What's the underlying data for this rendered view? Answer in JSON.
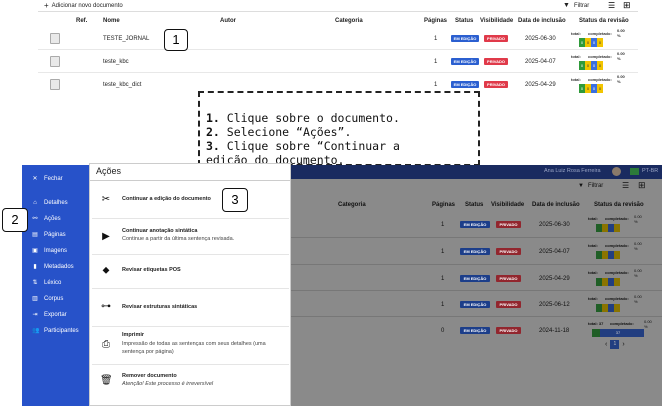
{
  "top": {
    "add_doc": "Adicionar novo documento",
    "filter": "Filtrar",
    "columns": {
      "ref": "Ref.",
      "name": "Nome",
      "author": "Autor",
      "category": "Categoria",
      "pages": "Páginas",
      "status": "Status",
      "visibility": "Visibilidade",
      "date": "Data de inclusão",
      "review": "Status da revisão"
    },
    "rows": [
      {
        "name": "TESTE_JORNAL",
        "pages": "1",
        "status": "EM EDIÇÃO",
        "visibility": "PRIVADO",
        "date": "2025-06-30",
        "prog": [
          "0",
          "0",
          "0",
          "0"
        ]
      },
      {
        "name": "teste_kbc",
        "pages": "1",
        "status": "EM EDIÇÃO",
        "visibility": "PRIVADO",
        "date": "2025-04-07",
        "prog": [
          "0",
          "0",
          "0",
          "0"
        ]
      },
      {
        "name": "teste_kbc_dict",
        "pages": "1",
        "status": "EM EDIÇÃO",
        "visibility": "PRIVADO",
        "date": "2025-04-29",
        "prog": [
          "0",
          "0",
          "0",
          "0"
        ]
      }
    ],
    "review_total": "total:",
    "review_done": "completado:",
    "review_pct": "0.00 %"
  },
  "callouts": {
    "one": "1",
    "two": "2",
    "three": "3"
  },
  "instructions": {
    "n1": "1.",
    "t1": " Clique sobre o documento.",
    "n2": "2.",
    "t2": " Selecione “Ações”.",
    "n3": "3.",
    "t3": " Clique sobre “Continuar a",
    "t4": "edição do documento."
  },
  "header_bar": {
    "user": "Ana Luiz Rosa Ferreira",
    "lang": "PT-BR"
  },
  "sidebar": {
    "close": "Fechar",
    "items": [
      {
        "label": "Detalhes",
        "icon": "home-icon"
      },
      {
        "label": "Ações",
        "icon": "link-icon"
      },
      {
        "label": "Páginas",
        "icon": "file-icon"
      },
      {
        "label": "Imagens",
        "icon": "image-icon"
      },
      {
        "label": "Metadados",
        "icon": "bookmark-icon"
      },
      {
        "label": "Léxico",
        "icon": "sort-icon"
      },
      {
        "label": "Corpus",
        "icon": "book-icon"
      },
      {
        "label": "Exportar",
        "icon": "export-icon"
      },
      {
        "label": "Participantes",
        "icon": "users-icon"
      }
    ]
  },
  "actions_panel": {
    "title": "Ações",
    "items": [
      {
        "title": "Continuar a edição do documento",
        "desc": ""
      },
      {
        "title": "Continuar anotação sintática",
        "desc": "Continue a partir da última sentença revisada."
      },
      {
        "title": "Revisar etiquetas POS",
        "desc": ""
      },
      {
        "title": "Revisar estruturas sintáticas",
        "desc": ""
      },
      {
        "title": "Imprimir",
        "desc": "Impressão de todas as sentenças com seus detalhes (uma sentença por página)"
      },
      {
        "title": "Remover documento",
        "desc": "Atenção! Este processo é irreversível"
      }
    ]
  },
  "bottom": {
    "filter": "Filtrar",
    "columns": {
      "category": "Categoria",
      "pages": "Páginas",
      "status": "Status",
      "visibility": "Visibilidade",
      "date": "Data de inclusão",
      "review": "Status da revisão"
    },
    "rows": [
      {
        "pages": "1",
        "status": "EM EDIÇÃO",
        "visibility": "PRIVADO",
        "date": "2025-06-30"
      },
      {
        "pages": "1",
        "status": "EM EDIÇÃO",
        "visibility": "PRIVADO",
        "date": "2025-04-07"
      },
      {
        "pages": "1",
        "status": "EM EDIÇÃO",
        "visibility": "PRIVADO",
        "date": "2025-04-29"
      },
      {
        "pages": "1",
        "status": "EM EDIÇÃO",
        "visibility": "PRIVADO",
        "date": "2025-06-12"
      },
      {
        "pages": "0",
        "status": "EM EDIÇÃO",
        "visibility": "PRIVADO",
        "date": "2024-11-18"
      }
    ],
    "last_review_total": "total: 37",
    "last_review_done": "completado:",
    "last_pct": "0.00 %",
    "last_prog": "37",
    "page": "1"
  },
  "colors": {
    "sidebar": "#2752c9",
    "blue_badge": "#2b5fd0",
    "red_badge": "#e03a4a",
    "prog_green": "#2f9a3a",
    "prog_yellow": "#f2c500",
    "prog_blue": "#3a6fe0"
  }
}
